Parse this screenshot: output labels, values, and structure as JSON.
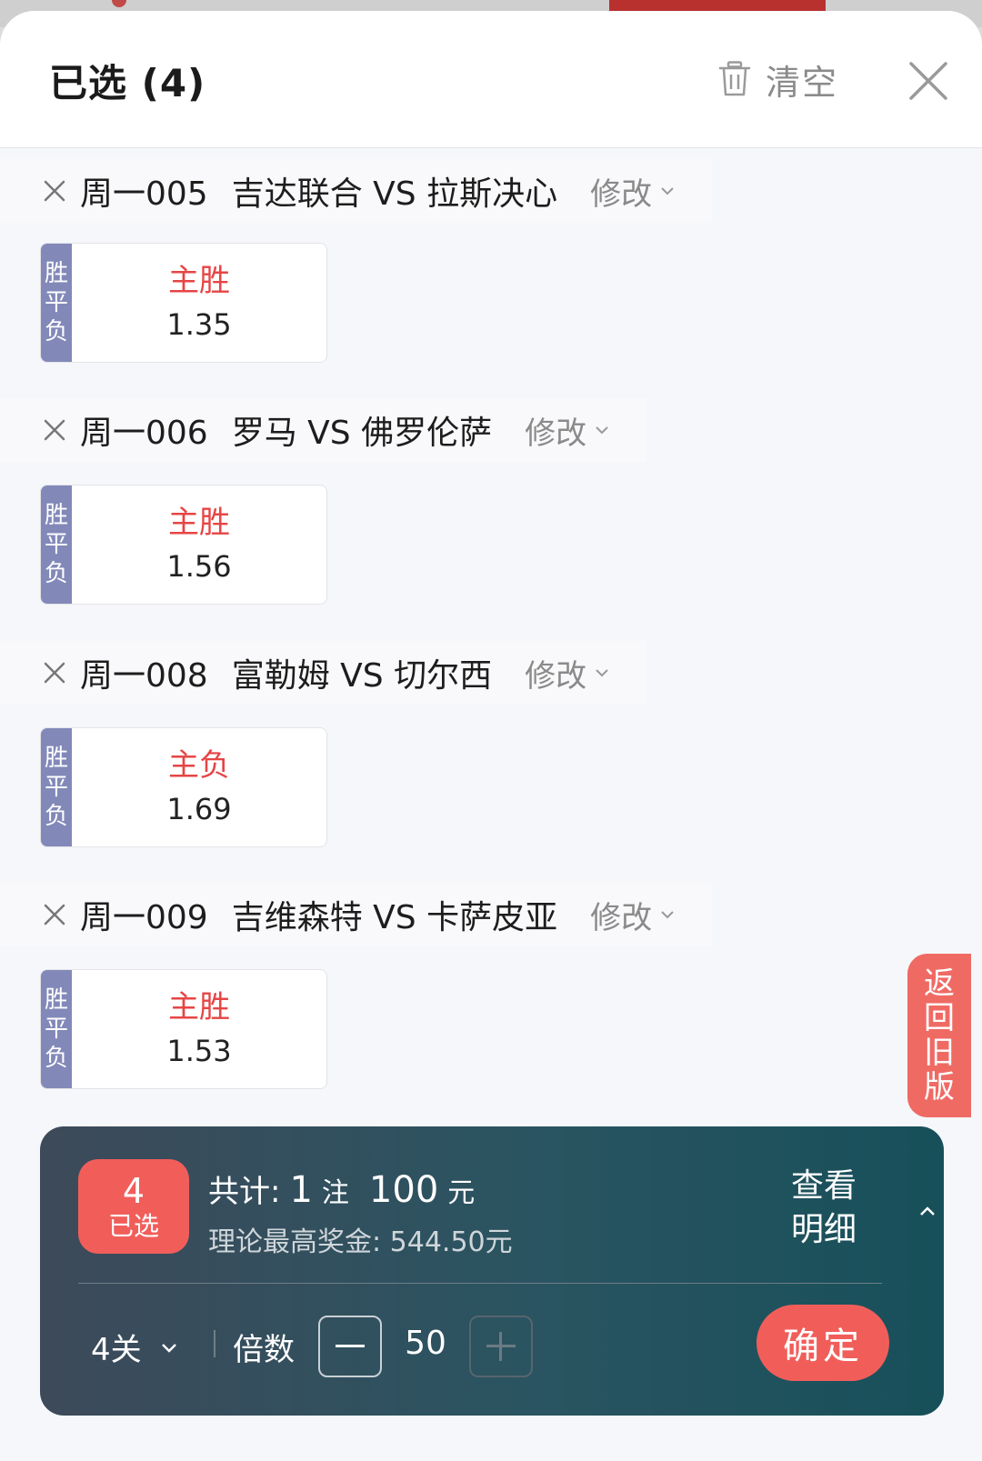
{
  "header": {
    "title": "已选 (4)",
    "clear_label": "清空"
  },
  "matches": [
    {
      "code": "周一005",
      "name": "吉达联合 VS 拉斯决心",
      "modify": "修改",
      "market": [
        "胜",
        "平",
        "负"
      ],
      "pick": "主胜",
      "odds": "1.35"
    },
    {
      "code": "周一006",
      "name": "罗马 VS 佛罗伦萨",
      "modify": "修改",
      "market": [
        "胜",
        "平",
        "负"
      ],
      "pick": "主胜",
      "odds": "1.56"
    },
    {
      "code": "周一008",
      "name": "富勒姆 VS 切尔西",
      "modify": "修改",
      "market": [
        "胜",
        "平",
        "负"
      ],
      "pick": "主负",
      "odds": "1.69"
    },
    {
      "code": "周一009",
      "name": "吉维森特 VS 卡萨皮亚",
      "modify": "修改",
      "market": [
        "胜",
        "平",
        "负"
      ],
      "pick": "主胜",
      "odds": "1.53"
    }
  ],
  "side_tab": {
    "chars": [
      "返",
      "回",
      "旧",
      "版"
    ]
  },
  "summary": {
    "selected_count": "4",
    "selected_label": "已选",
    "total_prefix": "共计:",
    "bets": "1",
    "bets_unit": "注",
    "amount": "100",
    "amount_unit": "元",
    "max_prize": "理论最高奖金: 544.50元",
    "detail_line1": "查看",
    "detail_line2": "明细",
    "pass_type": "4关",
    "multiplier_label": "倍数",
    "multiplier": "50",
    "confirm": "确定"
  },
  "colors": {
    "accent_red": "#f15e5a",
    "pick_red": "#e64545",
    "market_purple": "#8289b9",
    "bar_teal": "#17505a"
  }
}
